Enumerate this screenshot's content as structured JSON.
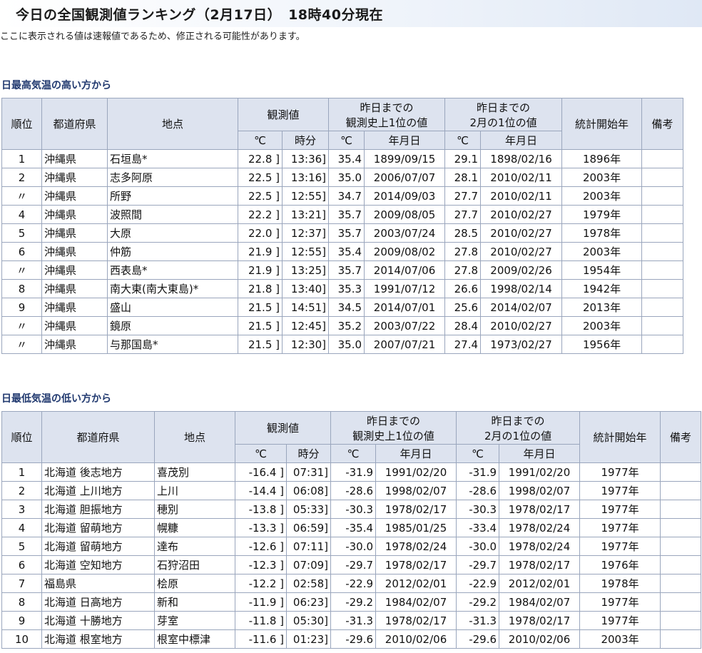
{
  "page": {
    "title": "今日の全国観測値ランキング（2月17日）　18時40分現在",
    "notice": "ここに表示される値は速報値であるため、修正される可能性があります。"
  },
  "high": {
    "section_title": "日最高気温の高い方から",
    "headers": {
      "rank": "順位",
      "pref": "都道府県",
      "point": "地点",
      "obs": "観測値",
      "hist_line1": "昨日までの",
      "hist_line2": "観測史上1位の値",
      "month_line1": "昨日までの",
      "month_line2": "2月の1位の値",
      "start": "統計開始年",
      "note": "備考",
      "deg": "℃",
      "time": "時分",
      "ymd": "年月日"
    },
    "rows": [
      {
        "rank": "1",
        "pref": "沖縄県",
        "point": "石垣島*",
        "val": "22.8 ]",
        "time": "13:36]",
        "hv": "35.4",
        "hd": "1899/09/15",
        "mv": "29.1",
        "md": "1898/02/16",
        "start": "1896年",
        "note": ""
      },
      {
        "rank": "2",
        "pref": "沖縄県",
        "point": "志多阿原",
        "val": "22.5 ]",
        "time": "13:16]",
        "hv": "35.0",
        "hd": "2006/07/07",
        "mv": "28.1",
        "md": "2010/02/11",
        "start": "2003年",
        "note": ""
      },
      {
        "rank": "〃",
        "pref": "沖縄県",
        "point": "所野",
        "val": "22.5 ]",
        "time": "12:55]",
        "hv": "34.7",
        "hd": "2014/09/03",
        "mv": "27.7",
        "md": "2010/02/11",
        "start": "2003年",
        "note": ""
      },
      {
        "rank": "4",
        "pref": "沖縄県",
        "point": "波照間",
        "val": "22.2 ]",
        "time": "13:21]",
        "hv": "35.7",
        "hd": "2009/08/05",
        "mv": "27.7",
        "md": "2010/02/27",
        "start": "1979年",
        "note": ""
      },
      {
        "rank": "5",
        "pref": "沖縄県",
        "point": "大原",
        "val": "22.0 ]",
        "time": "12:37]",
        "hv": "35.7",
        "hd": "2003/07/24",
        "mv": "28.5",
        "md": "2010/02/27",
        "start": "1978年",
        "note": ""
      },
      {
        "rank": "6",
        "pref": "沖縄県",
        "point": "仲筋",
        "val": "21.9 ]",
        "time": "12:55]",
        "hv": "35.4",
        "hd": "2009/08/02",
        "mv": "27.8",
        "md": "2010/02/27",
        "start": "2003年",
        "note": ""
      },
      {
        "rank": "〃",
        "pref": "沖縄県",
        "point": "西表島*",
        "val": "21.9 ]",
        "time": "13:25]",
        "hv": "35.7",
        "hd": "2014/07/06",
        "mv": "27.8",
        "md": "2009/02/26",
        "start": "1954年",
        "note": ""
      },
      {
        "rank": "8",
        "pref": "沖縄県",
        "point": "南大東(南大東島)*",
        "val": "21.8 ]",
        "time": "13:40]",
        "hv": "35.3",
        "hd": "1991/07/12",
        "mv": "26.6",
        "md": "1998/02/14",
        "start": "1942年",
        "note": ""
      },
      {
        "rank": "9",
        "pref": "沖縄県",
        "point": "盛山",
        "val": "21.5 ]",
        "time": "14:51]",
        "hv": "34.5",
        "hd": "2014/07/01",
        "mv": "25.6",
        "md": "2014/02/07",
        "start": "2013年",
        "note": ""
      },
      {
        "rank": "〃",
        "pref": "沖縄県",
        "point": "鏡原",
        "val": "21.5 ]",
        "time": "12:45]",
        "hv": "35.2",
        "hd": "2003/07/22",
        "mv": "28.4",
        "md": "2010/02/27",
        "start": "2003年",
        "note": ""
      },
      {
        "rank": "〃",
        "pref": "沖縄県",
        "point": "与那国島*",
        "val": "21.5 ]",
        "time": "12:30]",
        "hv": "35.0",
        "hd": "2007/07/21",
        "mv": "27.4",
        "md": "1973/02/27",
        "start": "1956年",
        "note": ""
      }
    ]
  },
  "low": {
    "section_title": "日最低気温の低い方から",
    "headers": {
      "rank": "順位",
      "pref": "都道府県",
      "point": "地点",
      "obs": "観測値",
      "hist_line1": "昨日までの",
      "hist_line2": "観測史上1位の値",
      "month_line1": "昨日までの",
      "month_line2": "2月の1位の値",
      "start": "統計開始年",
      "note": "備考",
      "deg": "℃",
      "time": "時分",
      "ymd": "年月日"
    },
    "rows": [
      {
        "rank": "1",
        "pref": "北海道 後志地方",
        "point": "喜茂別",
        "val": "-16.4 ]",
        "time": "07:31]",
        "hv": "-31.9",
        "hd": "1991/02/20",
        "mv": "-31.9",
        "md": "1991/02/20",
        "start": "1977年",
        "note": ""
      },
      {
        "rank": "2",
        "pref": "北海道 上川地方",
        "point": "上川",
        "val": "-14.4 ]",
        "time": "06:08]",
        "hv": "-28.6",
        "hd": "1998/02/07",
        "mv": "-28.6",
        "md": "1998/02/07",
        "start": "1977年",
        "note": ""
      },
      {
        "rank": "3",
        "pref": "北海道 胆振地方",
        "point": "穂別",
        "val": "-13.8 ]",
        "time": "05:33]",
        "hv": "-30.3",
        "hd": "1978/02/17",
        "mv": "-30.3",
        "md": "1978/02/17",
        "start": "1977年",
        "note": ""
      },
      {
        "rank": "4",
        "pref": "北海道 留萌地方",
        "point": "幌糠",
        "val": "-13.3 ]",
        "time": "06:59]",
        "hv": "-35.4",
        "hd": "1985/01/25",
        "mv": "-33.4",
        "md": "1978/02/24",
        "start": "1977年",
        "note": ""
      },
      {
        "rank": "5",
        "pref": "北海道 留萌地方",
        "point": "達布",
        "val": "-12.6 ]",
        "time": "07:11]",
        "hv": "-30.0",
        "hd": "1978/02/24",
        "mv": "-30.0",
        "md": "1978/02/24",
        "start": "1977年",
        "note": ""
      },
      {
        "rank": "6",
        "pref": "北海道 空知地方",
        "point": "石狩沼田",
        "val": "-12.3 ]",
        "time": "07:09]",
        "hv": "-29.7",
        "hd": "1978/02/17",
        "mv": "-29.7",
        "md": "1978/02/17",
        "start": "1976年",
        "note": ""
      },
      {
        "rank": "7",
        "pref": "福島県",
        "point": "桧原",
        "val": "-12.2 ]",
        "time": "02:58]",
        "hv": "-22.9",
        "hd": "2012/02/01",
        "mv": "-22.9",
        "md": "2012/02/01",
        "start": "1978年",
        "note": ""
      },
      {
        "rank": "8",
        "pref": "北海道 日高地方",
        "point": "新和",
        "val": "-11.9 ]",
        "time": "06:23]",
        "hv": "-29.2",
        "hd": "1984/02/07",
        "mv": "-29.2",
        "md": "1984/02/07",
        "start": "1977年",
        "note": ""
      },
      {
        "rank": "9",
        "pref": "北海道 十勝地方",
        "point": "芽室",
        "val": "-11.8 ]",
        "time": "05:30]",
        "hv": "-31.3",
        "hd": "1978/02/17",
        "mv": "-31.3",
        "md": "1978/02/17",
        "start": "1977年",
        "note": ""
      },
      {
        "rank": "10",
        "pref": "北海道 根室地方",
        "point": "根室中標津",
        "val": "-11.6 ]",
        "time": "01:23]",
        "hv": "-29.6",
        "hd": "2010/02/06",
        "mv": "-29.6",
        "md": "2010/02/06",
        "start": "2003年",
        "note": ""
      }
    ]
  }
}
